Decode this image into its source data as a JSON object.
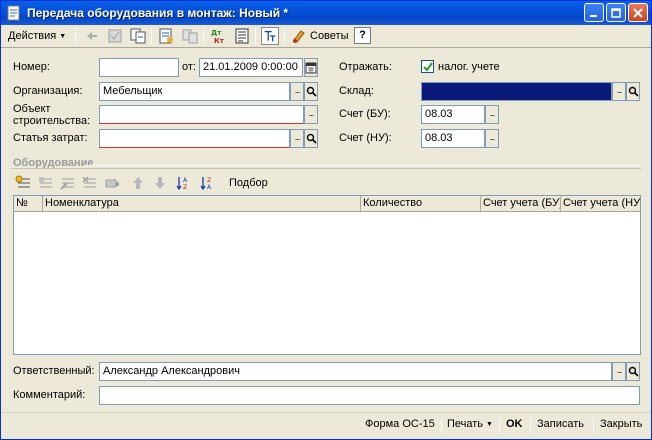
{
  "window": {
    "title": "Передача оборудования в монтаж: Новый *"
  },
  "toolbar": {
    "actions_label": "Действия",
    "advice_label": "Советы",
    "help_label": "?"
  },
  "form": {
    "number_label": "Номер:",
    "number_value": "",
    "date_label": "от:",
    "date_value": "21.01.2009  0:00:00",
    "reflect_label": "Отражать:",
    "tax_label": "налог. учете",
    "tax_checked": true,
    "org_label": "Организация:",
    "org_value": "Мебельщик",
    "warehouse_label": "Склад:",
    "warehouse_value": "",
    "object_label": "Объект строительства:",
    "object_value": "",
    "account_bu_label": "Счет (БУ):",
    "account_bu_value": "08.03",
    "cost_label": "Статья затрат:",
    "cost_value": "",
    "account_nu_label": "Счет (НУ):",
    "account_nu_value": "08.03"
  },
  "equipment": {
    "group_title": "Оборудование",
    "selection_label": "Подбор",
    "columns": [
      "№",
      "Номенклатура",
      "Количество",
      "Счет учета (БУ)",
      "Счет учета (НУ)"
    ],
    "rows": []
  },
  "footer": {
    "responsible_label": "Ответственный:",
    "responsible_value": "Александр Александрович",
    "comment_label": "Комментарий:",
    "comment_value": ""
  },
  "statusbar": {
    "form_label": "Форма ОС-15",
    "print_label": "Печать",
    "ok_label": "OK",
    "save_label": "Записать",
    "close_label": "Закрыть"
  },
  "colors": {
    "title_bar": "#0550d8",
    "window_bg": "#ece9d8",
    "selected_field": "#0a1a7a"
  }
}
